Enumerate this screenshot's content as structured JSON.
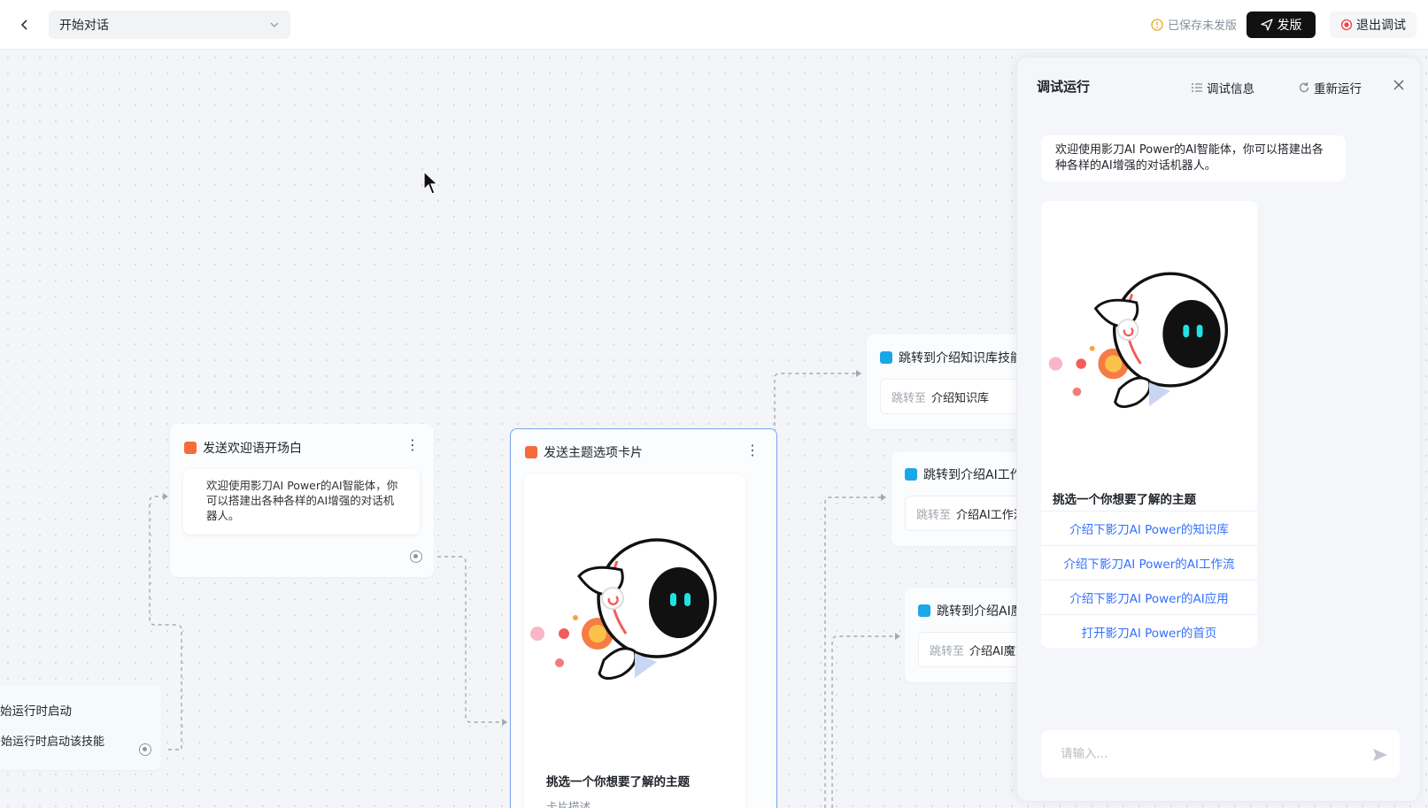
{
  "header": {
    "skill_name": "开始对话",
    "save_status": "已保存未发版",
    "publish_label": "发版",
    "exit_debug_label": "退出调试"
  },
  "canvas": {
    "start_node": {
      "title": "始运行时启动",
      "desc": "开始运行时启动该技能"
    },
    "welcome_node": {
      "title": "发送欢迎语开场白",
      "message": "欢迎使用影刀AI Power的AI智能体，你可以搭建出各种各样的AI增强的对话机器人。"
    },
    "card_node": {
      "title": "发送主题选项卡片",
      "card_title": "挑选一个你想要了解的主题",
      "card_desc": "卡片描述"
    },
    "jump_nodes": [
      {
        "title": "跳转到介绍知识库技能",
        "label": "跳转至",
        "target": "介绍知识库"
      },
      {
        "title": "跳转到介绍AI工作流技能",
        "label": "跳转至",
        "target": "介绍AI工作流"
      },
      {
        "title": "跳转到介绍AI魔方技能",
        "label": "跳转至",
        "target": "介绍AI魔方"
      }
    ]
  },
  "panel": {
    "title": "调试运行",
    "debug_info_label": "调试信息",
    "rerun_label": "重新运行",
    "welcome_message": "欢迎使用影刀AI Power的AI智能体，你可以搭建出各种各样的AI增强的对话机器人。",
    "card_title": "挑选一个你想要了解的主题",
    "options": [
      "介绍下影刀AI Power的知识库",
      "介绍下影刀AI Power的AI工作流",
      "介绍下影刀AI Power的AI应用",
      "打开影刀AI Power的首页"
    ],
    "input_placeholder": "请输入..."
  },
  "colors": {
    "accent_blue": "#3370ff",
    "node_orange": "#f56b3b",
    "node_blue": "#1aa7e8",
    "publish_bg": "#111111"
  }
}
